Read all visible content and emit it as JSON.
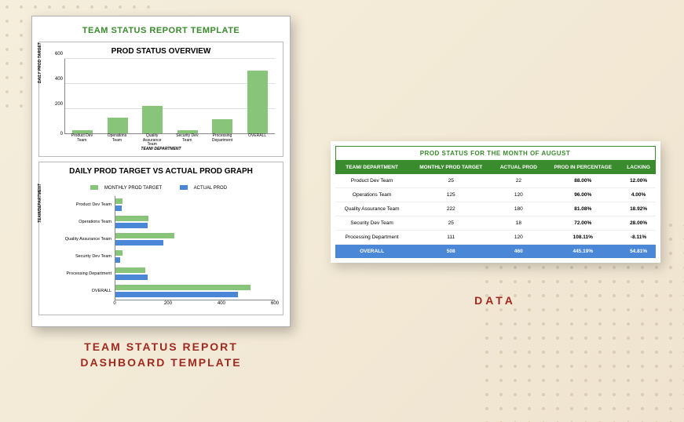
{
  "sheet": {
    "title": "TEAM STATUS REPORT TEMPLATE"
  },
  "chart1": {
    "title": "PROD STATUS OVERVIEW",
    "ylabel": "DAILY PROD TARGET",
    "xlabel": "TEAM/ DEPARTMENT",
    "ticks": [
      "0",
      "200",
      "400",
      "600"
    ]
  },
  "chart2": {
    "title": "DAILY PROD TARGET VS ACTUAL PROD GRAPH",
    "legend_a": "MONTHLY PROD TARGET",
    "legend_b": "ACTUAL PROD",
    "ylabel": "TEAM/DEPARTMENT",
    "xticks": [
      "0",
      "200",
      "400",
      "600"
    ]
  },
  "left_caption_l1": "TEAM STATUS REPORT",
  "left_caption_l2": "DASHBOARD TEMPLATE",
  "table": {
    "title": "PROD STATUS FOR THE MONTH OF AUGUST",
    "headers": [
      "TEAM/ DEPARTMENT",
      "MONTHLY PROD TARGET",
      "ACTUAL PROD",
      "PROD IN PERCENTAGE",
      "LACKING"
    ],
    "rows": [
      {
        "team": "Product Dev Team",
        "target": "25",
        "actual": "22",
        "pct": "88.00%",
        "lack": "12.00%"
      },
      {
        "team": "Operations Team",
        "target": "125",
        "actual": "120",
        "pct": "96.00%",
        "lack": "4.00%"
      },
      {
        "team": "Quality Assurance Team",
        "target": "222",
        "actual": "180",
        "pct": "81.08%",
        "lack": "18.92%"
      },
      {
        "team": "Security Dev Team",
        "target": "25",
        "actual": "18",
        "pct": "72.00%",
        "lack": "28.00%"
      },
      {
        "team": "Processing Department",
        "target": "111",
        "actual": "120",
        "pct": "108.11%",
        "lack": "-8.11%"
      }
    ],
    "footer": {
      "label": "OVERALL",
      "target": "508",
      "actual": "460",
      "pct": "445.19%",
      "lack": "54.81%"
    }
  },
  "right_caption": "DATA",
  "chart_data": [
    {
      "type": "bar",
      "title": "PROD STATUS OVERVIEW",
      "xlabel": "TEAM/ DEPARTMENT",
      "ylabel": "DAILY PROD TARGET",
      "ylim": [
        0,
        600
      ],
      "categories": [
        "Product Dev Team",
        "Operations Team",
        "Quality Assurance Team",
        "Security Dev Team",
        "Processing Department",
        "OVERALL"
      ],
      "values": [
        25,
        125,
        222,
        25,
        111,
        508
      ]
    },
    {
      "type": "bar",
      "orientation": "horizontal",
      "title": "DAILY PROD TARGET VS ACTUAL PROD GRAPH",
      "xlabel": "",
      "ylabel": "TEAM/DEPARTMENT",
      "xlim": [
        0,
        600
      ],
      "categories": [
        "Product Dev Team",
        "Operations Team",
        "Quality Assurance Team",
        "Security Dev Team",
        "Processing Department",
        "OVERALL"
      ],
      "series": [
        {
          "name": "MONTHLY PROD TARGET",
          "values": [
            25,
            125,
            222,
            25,
            111,
            508
          ]
        },
        {
          "name": "ACTUAL PROD",
          "values": [
            22,
            120,
            180,
            18,
            120,
            460
          ]
        }
      ]
    },
    {
      "type": "table",
      "title": "PROD STATUS FOR THE MONTH OF AUGUST",
      "columns": [
        "TEAM/ DEPARTMENT",
        "MONTHLY PROD TARGET",
        "ACTUAL PROD",
        "PROD IN PERCENTAGE",
        "LACKING"
      ],
      "rows": [
        [
          "Product Dev Team",
          25,
          22,
          "88.00%",
          "12.00%"
        ],
        [
          "Operations Team",
          125,
          120,
          "96.00%",
          "4.00%"
        ],
        [
          "Quality Assurance Team",
          222,
          180,
          "81.08%",
          "18.92%"
        ],
        [
          "Security Dev Team",
          25,
          18,
          "72.00%",
          "28.00%"
        ],
        [
          "Processing Department",
          111,
          120,
          "108.11%",
          "-8.11%"
        ],
        [
          "OVERALL",
          508,
          460,
          "445.19%",
          "54.81%"
        ]
      ]
    }
  ]
}
